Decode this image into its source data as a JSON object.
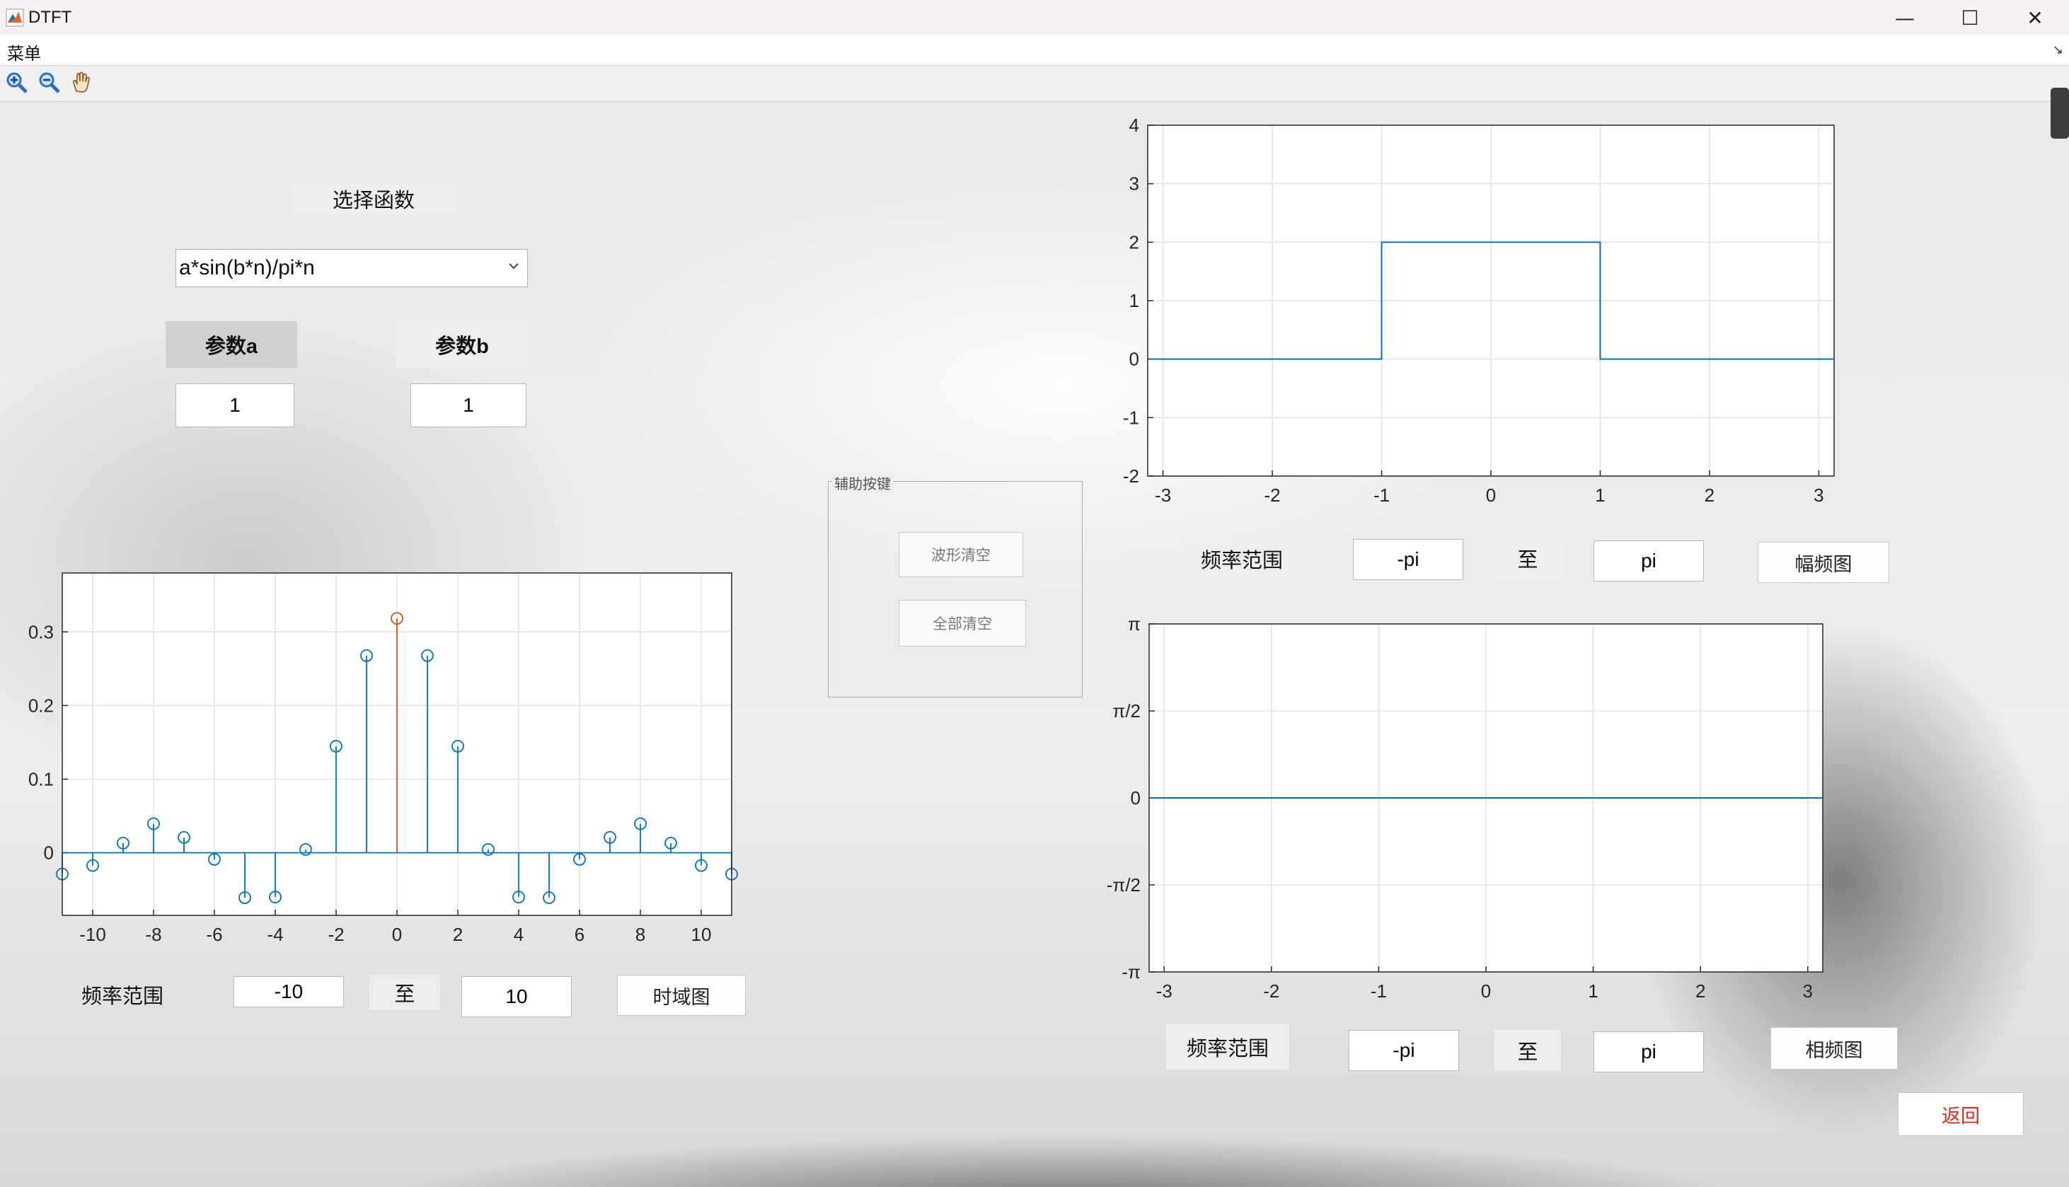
{
  "window": {
    "title": "DTFT",
    "minimize": "—",
    "maximize": "☐",
    "close": "✕"
  },
  "menubar": {
    "menu": "菜单",
    "corner": "↘"
  },
  "toolbar": {
    "icons": [
      "zoom-in-icon",
      "zoom-out-icon",
      "pan-hand-icon"
    ]
  },
  "controls": {
    "select_function_label": "选择函数",
    "function_dropdown": {
      "value": "a*sin(b*n)/pi*n"
    },
    "param_a_label": "参数a",
    "param_b_label": "参数b",
    "param_a_value": "1",
    "param_b_value": "1"
  },
  "helper_panel": {
    "title": "辅助按键",
    "clear_waveform": "波形清空",
    "clear_all": "全部清空"
  },
  "time_row": {
    "range_label": "频率范围",
    "from": "-10",
    "to_label": "至",
    "to": "10",
    "button": "时域图"
  },
  "mag_row": {
    "range_label": "频率范围",
    "from": "-pi",
    "to_label": "至",
    "to": "pi",
    "button": "幅频图"
  },
  "phase_row": {
    "range_label": "频率范围",
    "from": "-pi",
    "to_label": "至",
    "to": "pi",
    "button": "相频图"
  },
  "back_button": "返回",
  "colors": {
    "series": "#0072BD",
    "highlight": "#D95319",
    "back_text": "#d62b1f"
  },
  "chart_data": [
    {
      "type": "scatter",
      "style": "stem",
      "x": [
        -11,
        -10,
        -9,
        -8,
        -7,
        -6,
        -5,
        -4,
        -3,
        -2,
        -1,
        0,
        1,
        2,
        3,
        4,
        5,
        6,
        7,
        8,
        9,
        10,
        11
      ],
      "y": [
        -0.0289,
        -0.0173,
        0.0131,
        0.0394,
        0.0209,
        -0.0089,
        -0.061,
        -0.0602,
        0.0045,
        0.1447,
        0.2678,
        0.3183,
        0.2678,
        0.1447,
        0.0045,
        -0.0602,
        -0.061,
        -0.0089,
        0.0209,
        0.0394,
        0.0131,
        -0.0173,
        -0.0289
      ],
      "highlight_x": 0,
      "xlim": [
        -11,
        11
      ],
      "ylim": [
        -0.085,
        0.38
      ],
      "xticks": [
        "-10",
        "-8",
        "-6",
        "-4",
        "-2",
        "0",
        "2",
        "4",
        "6",
        "8",
        "10"
      ],
      "yticks": [
        "0",
        "0.1",
        "0.2",
        "0.3"
      ],
      "grid": true
    },
    {
      "type": "line",
      "x": [
        -3.14,
        -1,
        -1,
        1,
        1,
        3.14
      ],
      "y": [
        0,
        0,
        2,
        2,
        0,
        0
      ],
      "xlim": [
        -3.14,
        3.14
      ],
      "ylim": [
        -2,
        4
      ],
      "xticks": [
        "-3",
        "-2",
        "-1",
        "0",
        "1",
        "2",
        "3"
      ],
      "yticks": [
        "-2",
        "-1",
        "0",
        "1",
        "2",
        "3",
        "4"
      ],
      "grid": true
    },
    {
      "type": "line",
      "x": [
        -3.14,
        3.14
      ],
      "y": [
        0,
        0
      ],
      "xlim": [
        -3.14,
        3.14
      ],
      "ylim": [
        -3.1416,
        3.1416
      ],
      "xticks": [
        "-3",
        "-2",
        "-1",
        "0",
        "1",
        "2",
        "3"
      ],
      "yticks": [
        "-π",
        "-π/2",
        "0",
        "π/2",
        "π"
      ],
      "grid": true
    }
  ]
}
